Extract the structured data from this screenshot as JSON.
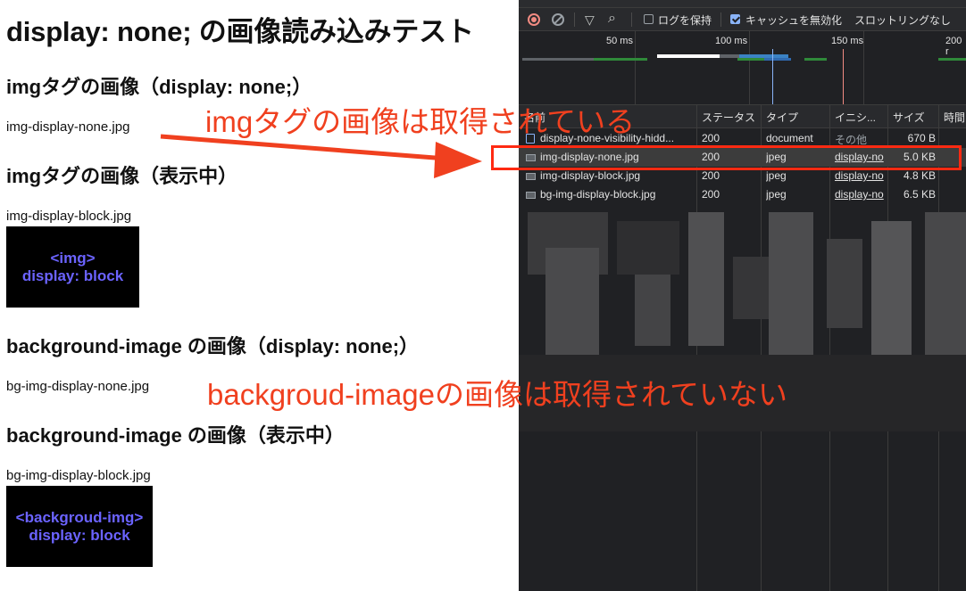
{
  "page": {
    "title": "display: none; の画像読み込みテスト",
    "sections": [
      {
        "heading": "imgタグの画像（display: none;）",
        "filename": "img-display-none.jpg"
      },
      {
        "heading": "imgタグの画像（表示中）",
        "filename": "img-display-block.jpg",
        "image_line1": "<img>",
        "image_line2": "display: block"
      },
      {
        "heading": "background-image の画像（display: none;）",
        "filename": "bg-img-display-none.jpg"
      },
      {
        "heading": "background-image の画像（表示中）",
        "filename": "bg-img-display-block.jpg",
        "image_line1": "<backgroud-img>",
        "image_line2": "display: block"
      }
    ]
  },
  "devtools": {
    "toolbar": {
      "preserve_log_label": "ログを保持",
      "preserve_log_checked": false,
      "disable_cache_label": "キャッシュを無効化",
      "disable_cache_checked": true,
      "throttling_label": "スロットリングなし"
    },
    "timeline": {
      "ticks": [
        "50 ms",
        "100 ms",
        "150 ms",
        "200 r"
      ]
    },
    "columns": [
      "名前",
      "ステータス",
      "タイプ",
      "イニシ...",
      "サイズ",
      "時間"
    ],
    "rows": [
      {
        "name": "display-none-visibility-hidd...",
        "status": "200",
        "type": "document",
        "initiator": "その他",
        "size": "670 B",
        "icon": "document-icon",
        "selected": false
      },
      {
        "name": "img-display-none.jpg",
        "status": "200",
        "type": "jpeg",
        "initiator": "display-no",
        "size": "5.0 KB",
        "icon": "image-icon",
        "selected": true
      },
      {
        "name": "img-display-block.jpg",
        "status": "200",
        "type": "jpeg",
        "initiator": "display-no",
        "size": "4.8 KB",
        "icon": "image-icon",
        "selected": false
      },
      {
        "name": "bg-img-display-block.jpg",
        "status": "200",
        "type": "jpeg",
        "initiator": "display-no",
        "size": "6.5 KB",
        "icon": "image-icon",
        "selected": false
      }
    ]
  },
  "annotations": {
    "top": "imgタグの画像は取得されている",
    "bottom": "backgroud-imageの画像は取得されていない",
    "color": "#f0401f"
  }
}
